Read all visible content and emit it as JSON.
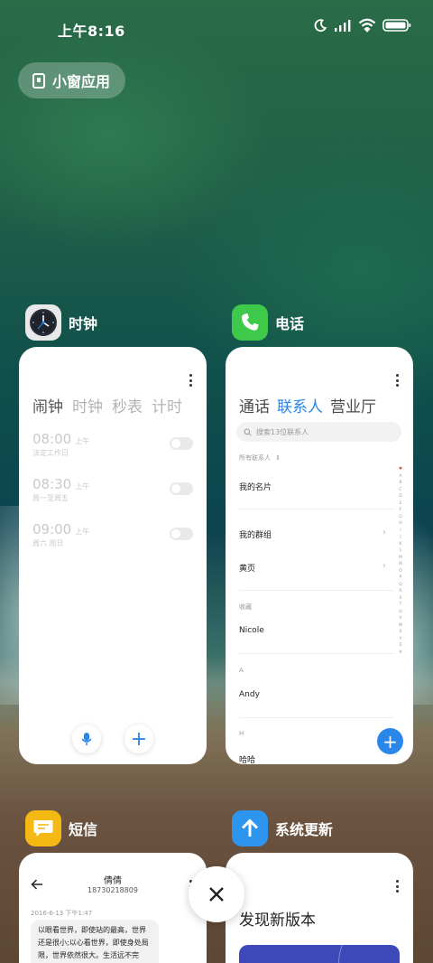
{
  "status_bar": {
    "time": "上午8:16",
    "icons": [
      "moon-icon",
      "signal-icon",
      "wifi-icon",
      "battery-icon"
    ]
  },
  "floating_window_button": {
    "label": "小窗应用",
    "icon": "floating-window-icon"
  },
  "apps": {
    "clock": {
      "name": "时钟",
      "icon": "clock-icon",
      "tabs": [
        "闹钟",
        "时钟",
        "秒表",
        "计时"
      ],
      "active_tab": "闹钟",
      "alarms": [
        {
          "time": "08:00",
          "ampm": "上午",
          "repeat": "法定工作日",
          "enabled": false
        },
        {
          "time": "08:30",
          "ampm": "上午",
          "repeat": "周一至周五",
          "enabled": false
        },
        {
          "time": "09:00",
          "ampm": "上午",
          "repeat": "周六 周日",
          "enabled": false
        }
      ],
      "buttons": {
        "voice": "mic-icon",
        "add": "+"
      }
    },
    "phone": {
      "name": "电话",
      "icon": "phone-icon",
      "tabs": [
        "通话",
        "联系人",
        "营业厅"
      ],
      "active_tab": "联系人",
      "search_placeholder": "搜索13位联系人",
      "filter_label": "所有联系人",
      "my_card": "我的名片",
      "my_groups": "我的群组",
      "yellow_pages": "黄页",
      "favorites_header": "收藏",
      "favorite_contact": "Nicole",
      "section_a": "A",
      "contact_a": "Andy",
      "section_h": "H",
      "contact_h": "哈哈",
      "index_letters": [
        "♥",
        "A",
        "B",
        "C",
        "D",
        "E",
        "F",
        "G",
        "H",
        "I",
        "J",
        "K",
        "L",
        "M",
        "N",
        "O",
        "P",
        "Q",
        "R",
        "S",
        "T",
        "U",
        "V",
        "W",
        "X",
        "Y",
        "Z",
        "#"
      ],
      "fab": "+"
    },
    "sms": {
      "name": "短信",
      "icon": "message-icon",
      "contact_name": "倩倩",
      "contact_number": "18730218809",
      "date": "2016-6-13 下午1:47",
      "message": "以眼看世界，即使站的最高，世界还是很小;以心看世界，即使身处局限，世界依然很大。生活远不完"
    },
    "update": {
      "name": "系统更新",
      "icon": "arrow-up-icon",
      "title": "发现新版本"
    }
  },
  "close_button": {
    "icon": "close-icon"
  },
  "colors": {
    "accent_blue": "#2a86e8",
    "phone_green": "#3ec94a",
    "sms_yellow": "#f5b914",
    "update_blue": "#2d95ee",
    "banner_blue": "#3d49b8"
  }
}
